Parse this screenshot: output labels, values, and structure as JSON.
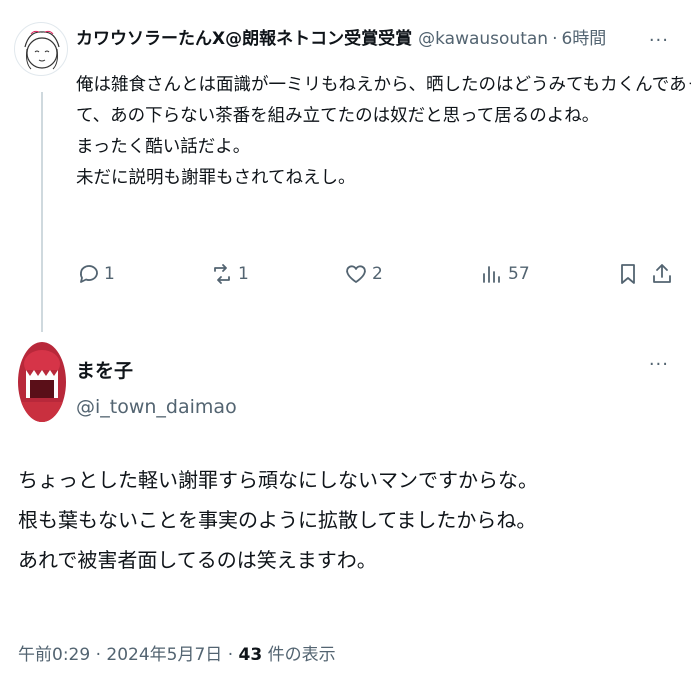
{
  "reply": {
    "author_name": "カワウソラーたんX@朗報ネトコン受賞受賞",
    "handle": "@kawausoutan",
    "separator": "·",
    "time": "6時間",
    "more": "···",
    "lines": [
      "俺は雑食さんとは面識が一ミリもねえから、晒したのはどうみてもカくんであっ",
      "て、あの下らない茶番を組み立てたのは奴だと思って居るのよね。",
      "まったく酷い話だよ。",
      "未だに説明も謝罪もされてねえし。"
    ],
    "actions": {
      "reply_count": "1",
      "retweet_count": "1",
      "like_count": "2",
      "views_count": "57"
    }
  },
  "main": {
    "author_name": "まを子",
    "handle": "@i_town_daimao",
    "more": "···",
    "lines": [
      "ちょっとした軽い謝罪すら頑なにしないマンですからな。",
      "根も葉もないことを事実のように拡散してましたからね。",
      "あれで被害者面してるのは笑えますわ。"
    ],
    "meta": {
      "time": "午前0:29",
      "separator": "·",
      "date": "2024年5月7日",
      "separator2": "·",
      "views_count": "43",
      "views_label": "件の表示"
    }
  }
}
